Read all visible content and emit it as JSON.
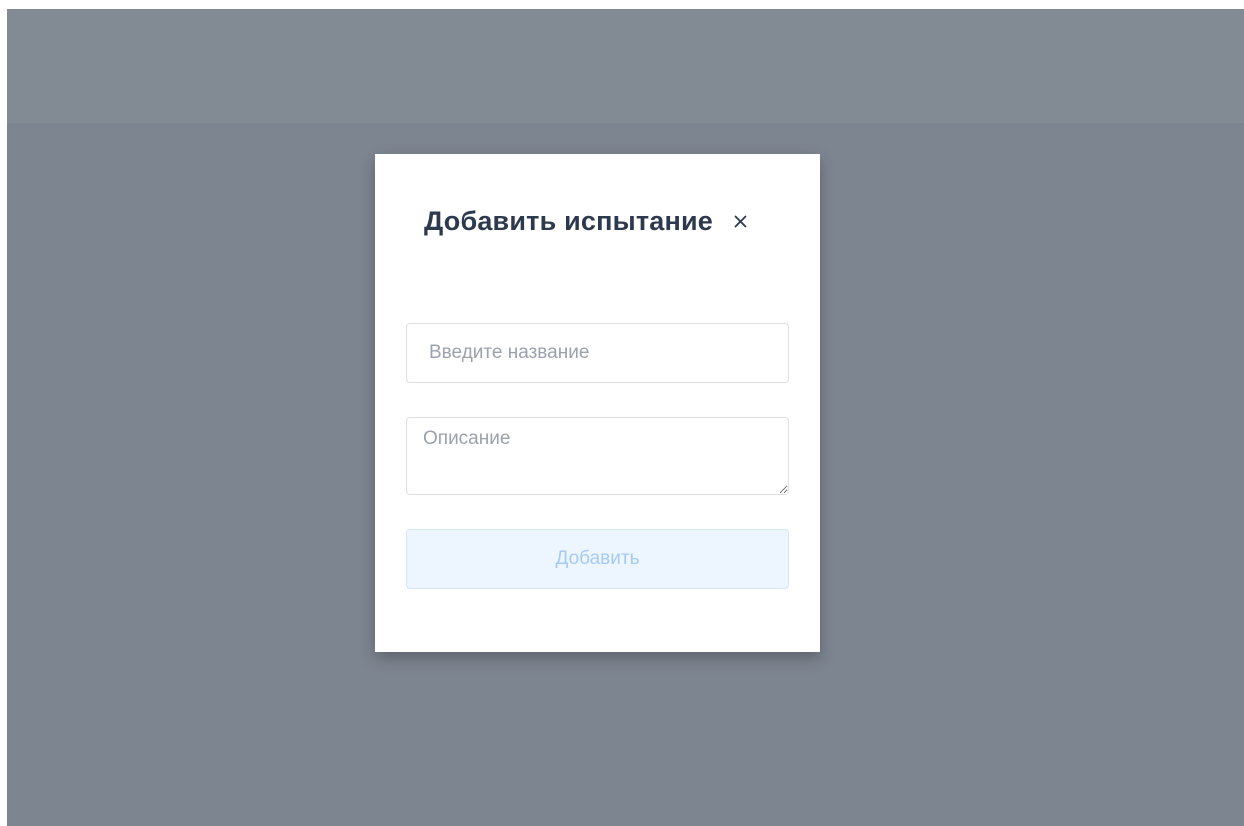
{
  "modal": {
    "title": "Добавить испытание",
    "close_icon": "close-icon",
    "name_input": {
      "value": "",
      "placeholder": "Введите название"
    },
    "description_input": {
      "value": "",
      "placeholder": "Описание"
    },
    "submit_label": "Добавить"
  },
  "colors": {
    "overlay": "#7d8590",
    "title": "#2d3a4d",
    "button_bg": "#edf5fe",
    "button_text": "#a6cbf2"
  }
}
